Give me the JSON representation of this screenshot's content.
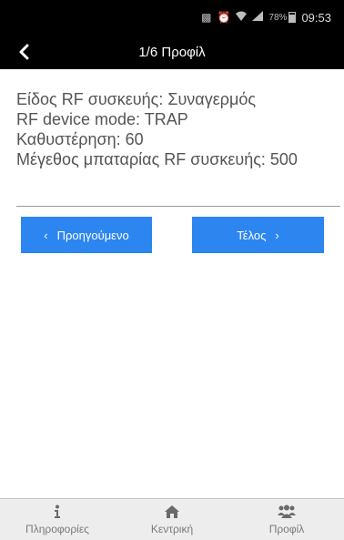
{
  "status_bar": {
    "battery_percent": "78%",
    "time": "09:53"
  },
  "header": {
    "title": "1/6 Προφίλ"
  },
  "info": {
    "rf_type": "Είδος RF συσκευής: Συναγερμός",
    "rf_mode": "RF device mode: TRAP",
    "delay": "Καθυστέρηση: 60",
    "battery_size": "Μέγεθος μπαταρίας RF συσκευής: 500"
  },
  "buttons": {
    "prev_label": "Προηγούμενο",
    "next_label": "Τέλος"
  },
  "tabs": [
    {
      "label": "Πληροφορίες",
      "icon": "info-icon"
    },
    {
      "label": "Κεντρική",
      "icon": "home-icon"
    },
    {
      "label": "Προφίλ",
      "icon": "users-icon"
    }
  ],
  "colors": {
    "header_bg": "#000000",
    "button_bg": "#2d86f0",
    "tabbar_bg": "#ededed"
  }
}
